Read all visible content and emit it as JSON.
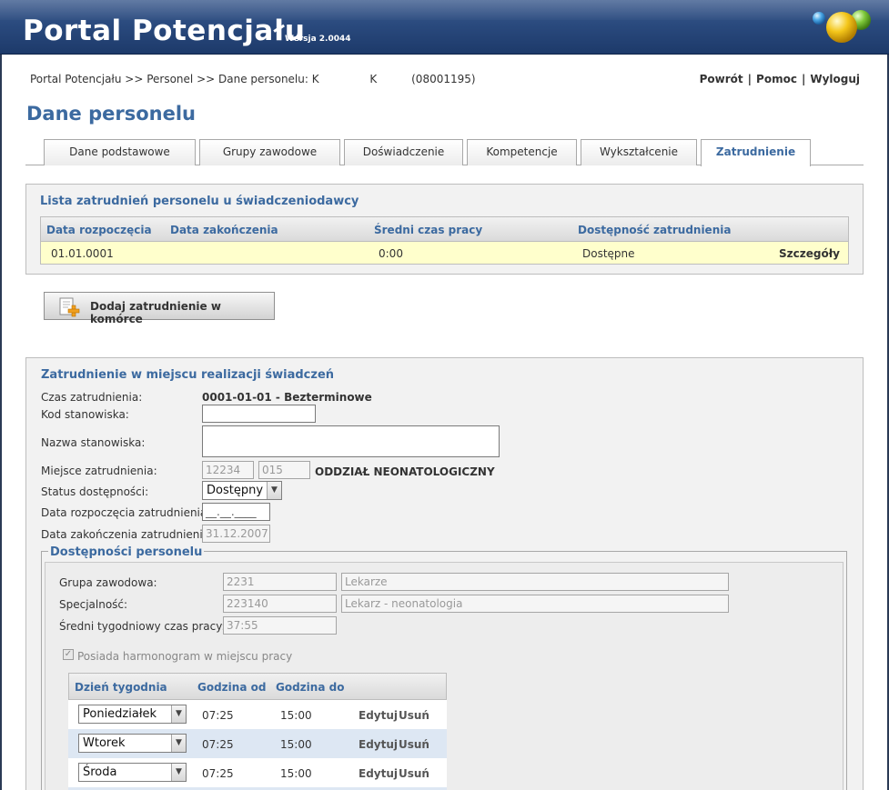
{
  "header": {
    "title": "Portal Potencjału",
    "version": "Wersja 2.0044"
  },
  "breadcrumb": {
    "items": [
      "Portal Potencjału",
      ">>",
      "Personel",
      ">>",
      "Dane personelu: K",
      "K",
      "(08001195)"
    ]
  },
  "top_links": {
    "back": "Powrót",
    "help": "Pomoc",
    "logout": "Wyloguj",
    "separator": "|"
  },
  "page": {
    "title": "Dane personelu"
  },
  "tabs": [
    {
      "label": "Dane podstawowe",
      "active": false
    },
    {
      "label": "Grupy zawodowe",
      "active": false
    },
    {
      "label": "Doświadczenie",
      "active": false
    },
    {
      "label": "Kompetencje",
      "active": false
    },
    {
      "label": "Wykształcenie",
      "active": false
    },
    {
      "label": "Zatrudnienie",
      "active": true
    }
  ],
  "employment_list": {
    "title": "Lista zatrudnień personelu u świadczeniodawcy",
    "columns": [
      "Data rozpoczęcia",
      "Data zakończenia",
      "Średni czas pracy",
      "Dostępność zatrudnienia"
    ],
    "rows": [
      {
        "start": "01.01.0001",
        "end": "",
        "avg_time": "0:00",
        "availability": "Dostępne",
        "details": "Szczegóły"
      }
    ]
  },
  "add_button": {
    "label": "Dodaj zatrudnienie w komórce",
    "icon": "add-document-icon"
  },
  "place": {
    "title": "Zatrudnienie w miejscu realizacji świadczeń",
    "labels": {
      "period": "Czas zatrudnienia:",
      "position_code": "Kod stanowiska:",
      "position_name": "Nazwa stanowiska:",
      "workplace": "Miejsce zatrudnienia:",
      "status": "Status dostępności:",
      "start_date": "Data rozpoczęcia zatrudnienia:",
      "end_date": "Data zakończenia zatrudnienia:"
    },
    "values": {
      "period": "0001-01-01 - Bezterminowe",
      "position_code": "",
      "position_name": "",
      "workplace_code1": "12234",
      "workplace_code2": "015",
      "workplace_name": "ODDZIAŁ NEONATOLOGICZNY",
      "status": "Dostępny",
      "start_date": "__.__.____",
      "end_date": "31.12.2007"
    }
  },
  "availability": {
    "legend": "Dostępności personelu",
    "labels": {
      "group": "Grupa zawodowa:",
      "specialty": "Specjalność:",
      "avg_week": "Średni tygodniowy czas pracy:",
      "has_schedule": "Posiada harmonogram w miejscu pracy"
    },
    "values": {
      "group_code": "2231",
      "group_name": "Lekarze",
      "specialty_code": "223140",
      "specialty_name": "Lekarz - neonatologia",
      "avg_week": "37:55",
      "has_schedule": true
    },
    "schedule": {
      "columns": [
        "Dzień tygodnia",
        "Godzina od",
        "Godzina do"
      ],
      "rows": [
        {
          "day": "Poniedziałek",
          "from": "07:25",
          "to": "15:00",
          "edit": "Edytuj",
          "delete": "Usuń"
        },
        {
          "day": "Wtorek",
          "from": "07:25",
          "to": "15:00",
          "edit": "Edytuj",
          "delete": "Usuń"
        },
        {
          "day": "Środa",
          "from": "07:25",
          "to": "15:00",
          "edit": "Edytuj",
          "delete": "Usuń"
        }
      ]
    }
  },
  "colors": {
    "header_bg": "#2a4a7e",
    "accent": "#3c6aa0",
    "row_highlight": "#ffffcc",
    "row_alt": "#dde7f3"
  }
}
